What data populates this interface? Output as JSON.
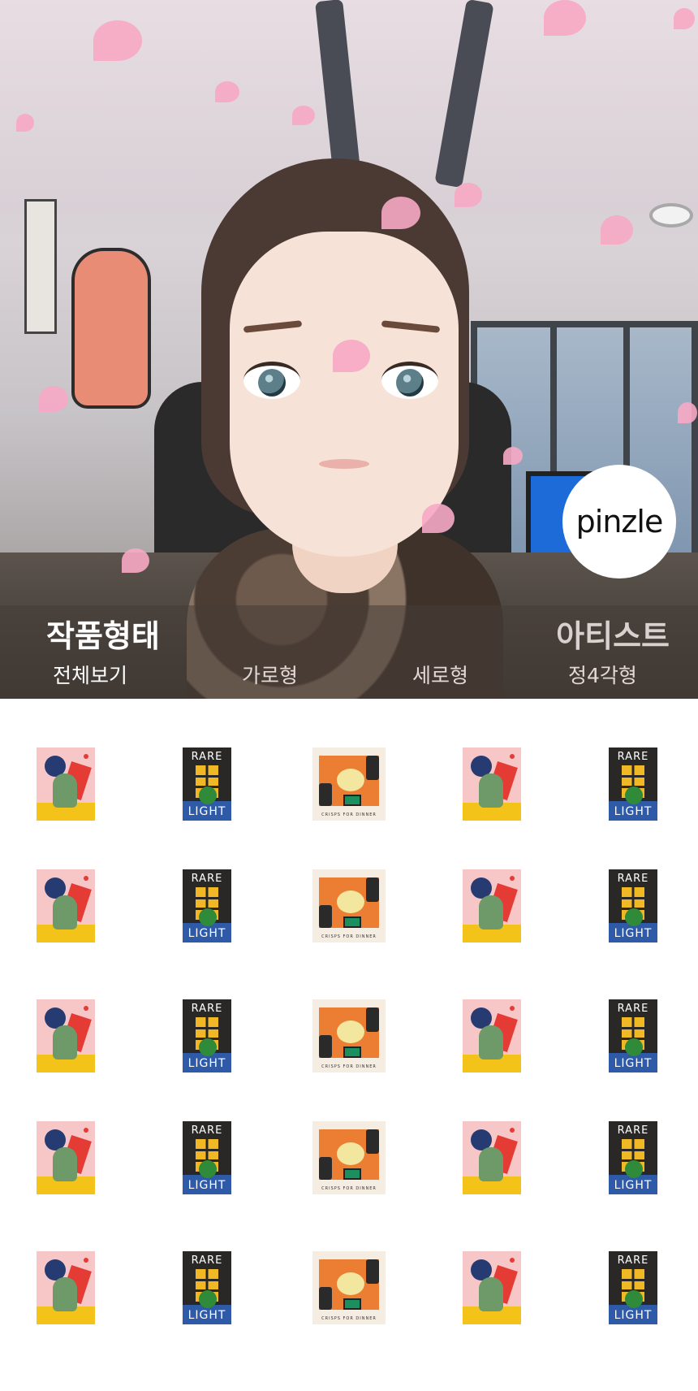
{
  "hero": {
    "logo_text": "pinzle"
  },
  "filter": {
    "title": "작품형태",
    "artist_link": "아티스트",
    "tabs": [
      {
        "label": "전체보기",
        "active": true
      },
      {
        "label": "가로형",
        "active": false
      },
      {
        "label": "세로형",
        "active": false
      },
      {
        "label": "정4각형",
        "active": false
      }
    ]
  },
  "artworks": {
    "rows": 5,
    "columns": [
      "pink-abstract",
      "rare-light",
      "crisps-for-dinner",
      "pink-abstract",
      "rare-light"
    ],
    "rare_light_top": "RARE",
    "rare_light_bottom": "LIGHT",
    "crisps_caption": "CRISPS FOR DINNER"
  },
  "colors": {
    "accent_pink": "#f7a9c4",
    "filter_overlay": "#463c37",
    "white": "#ffffff"
  }
}
